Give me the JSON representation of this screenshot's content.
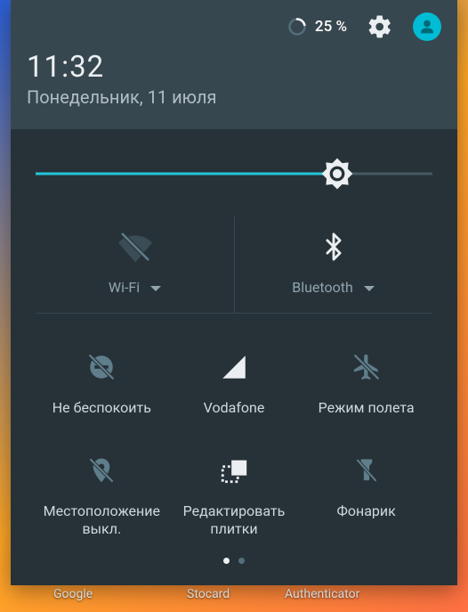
{
  "status": {
    "battery_pct": "25 %"
  },
  "time": "11:32",
  "date": "Понедельник, 11 июля",
  "brightness": {
    "value_pct": 76
  },
  "tiles": {
    "wifi": {
      "label": "Wi-Fi"
    },
    "bluetooth": {
      "label": "Bluetooth"
    },
    "dnd": {
      "label": "Не беспокоить"
    },
    "cellular": {
      "label": "Vodafone"
    },
    "airplane": {
      "label": "Режим полета"
    },
    "location": {
      "label": "Местоположение выкл."
    },
    "edit": {
      "label": "Редактировать плитки"
    },
    "flashlight": {
      "label": "Фонарик"
    }
  },
  "pager": {
    "count": 2,
    "active": 0
  },
  "colors": {
    "panel_bg": "#263238",
    "header_bg": "#37474f",
    "accent": "#26c6da",
    "avatar": "#00bcd4",
    "icon_inactive": "#607d8b",
    "icon_active": "#ffffff",
    "text_secondary": "#90a4ae"
  }
}
